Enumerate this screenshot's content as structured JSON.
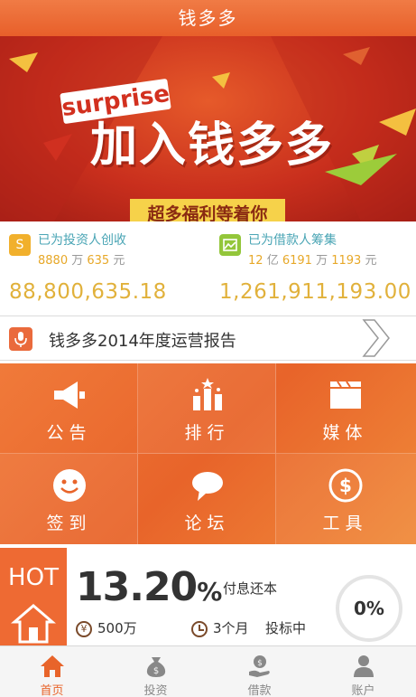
{
  "app": {
    "title": "钱多多"
  },
  "banner": {
    "badge": "surprise",
    "headline": "加入钱多多",
    "ribbon": "超多福利等着你",
    "slides": 3,
    "active_slide": 2
  },
  "stats": {
    "investors": {
      "label": "已为投资人创收",
      "wan": "8880",
      "wan_unit": "万",
      "yuan": "635",
      "yuan_unit": "元",
      "total": "88,800,635.18",
      "icon": "dollar-icon"
    },
    "borrowers": {
      "label": "已为借款人筹集",
      "yi": "12",
      "yi_unit": "亿",
      "wan": "6191",
      "wan_unit": "万",
      "yuan": "1193",
      "yuan_unit": "元",
      "total": "1,261,911,193.00",
      "icon": "chart-icon"
    }
  },
  "report": {
    "title": "钱多多2014年度运营报告"
  },
  "grid": {
    "items": [
      {
        "label": "公告",
        "icon": "megaphone-icon"
      },
      {
        "label": "排行",
        "icon": "ranking-icon"
      },
      {
        "label": "媒体",
        "icon": "clapperboard-icon"
      },
      {
        "label": "签到",
        "icon": "smile-icon"
      },
      {
        "label": "论坛",
        "icon": "chat-bubble-icon"
      },
      {
        "label": "工具",
        "icon": "calculator-icon"
      }
    ]
  },
  "product": {
    "tag": "HOT",
    "rate": "13.20",
    "rate_unit": "%",
    "repayment": "付息还本",
    "amount": "500万",
    "amount_icon": "¥",
    "term": "3个月",
    "status": "投标中",
    "progress": "0%"
  },
  "tabs": [
    {
      "label": "首页",
      "icon": "home-icon",
      "active": true
    },
    {
      "label": "投资",
      "icon": "money-bag-icon",
      "active": false
    },
    {
      "label": "借款",
      "icon": "hand-coin-icon",
      "active": false
    },
    {
      "label": "账户",
      "icon": "user-icon",
      "active": false
    }
  ],
  "colors": {
    "brand_orange": "#e8642a",
    "gold": "#e1b13b",
    "teal_label": "#4aa5b5"
  }
}
